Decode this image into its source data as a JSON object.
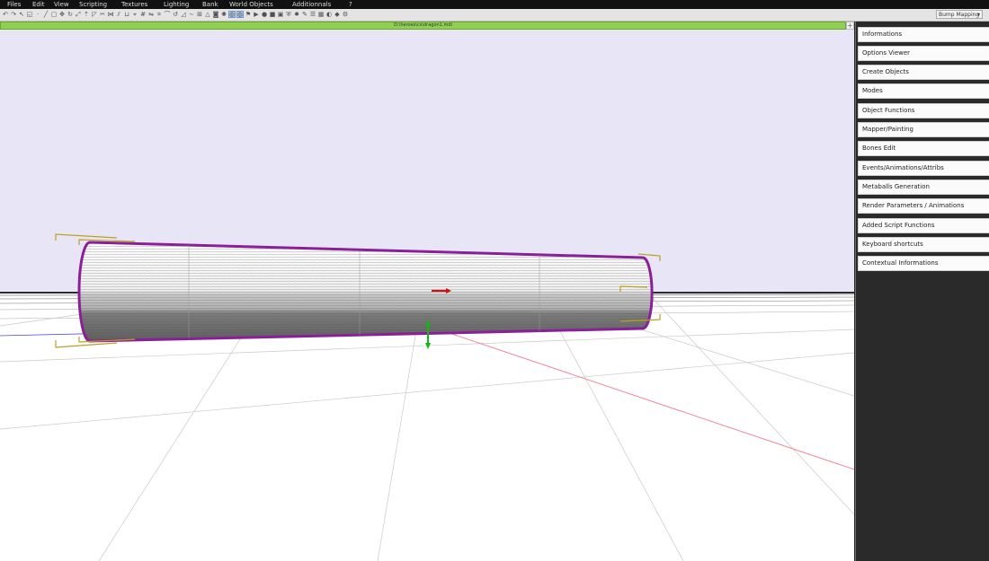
{
  "menu": [
    "Files",
    "Edit",
    "View",
    "Scripting",
    "Textures",
    "Lighting",
    "Bank",
    "World Objects",
    "Additionnals",
    "?"
  ],
  "toolbar": {
    "render_mode": "Bump Mapping",
    "icons": [
      "undo-icon",
      "redo-icon",
      "cursor-icon",
      "select-icon",
      "vertex-icon",
      "edge-icon",
      "face-icon",
      "move-icon",
      "rotate-icon",
      "scale-icon",
      "extrude-icon",
      "bevel-icon",
      "cut-icon",
      "weld-icon",
      "split-icon",
      "merge-icon",
      "snap-icon",
      "grid-icon",
      "mirror-icon",
      "lattice-icon",
      "bend-icon",
      "twist-icon",
      "taper-icon",
      "smooth-icon",
      "subdivide-icon",
      "triangulate-icon",
      "camera-icon",
      "light-icon",
      "sphere-icon",
      "globe-icon",
      "flag-icon",
      "play-icon",
      "record-icon",
      "stop-icon",
      "cube-icon",
      "shield-icon",
      "bomb-icon",
      "paint-icon",
      "layers-icon",
      "texture-icon",
      "sphere-shade-icon",
      "diamond-icon",
      "settings-icon"
    ],
    "active_icons": [
      "sphere-icon",
      "globe-icon"
    ]
  },
  "path": "D:\\heroes\\cs\\dragon1.mdl",
  "viewport": {
    "background": "#e8e6f6",
    "selection_color": "#8b1f9a"
  },
  "panel": {
    "buttons": [
      "Informations",
      "Options Viewer",
      "Create Objects",
      "Modes",
      "Object Functions",
      "Mapper/Painting",
      "Bones Edit",
      "Events/Animations/Attribs",
      "Metaballs Generation",
      "Render Parameters / Animations",
      "Added Script Functions",
      "Keyboard shortcuts",
      "Contextual Informations"
    ]
  }
}
